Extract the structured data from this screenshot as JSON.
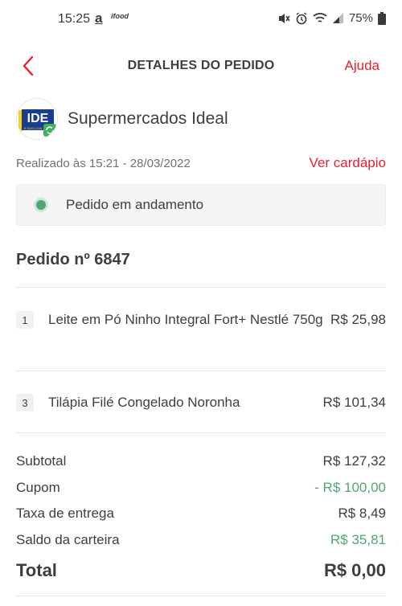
{
  "status_bar": {
    "time": "15:25",
    "a_icon": "a",
    "app_badge": "ifood",
    "battery": "75%"
  },
  "header": {
    "title": "DETALHES DO PEDIDO",
    "help": "Ajuda"
  },
  "store": {
    "name": "Supermercados Ideal",
    "logo_text": "IDE",
    "logo_sub": "A SUA LOJA",
    "date": "Realizado às 15:21 - 28/03/2022",
    "menu_link": "Ver cardápio"
  },
  "order": {
    "status": "Pedido em andamento",
    "number": "Pedido nº 6847",
    "items": [
      {
        "qty": "1",
        "name": "Leite em Pó Ninho Integral Fort+ Nestlé 750g",
        "price": "R$ 25,98"
      },
      {
        "qty": "3",
        "name": "Tilápia Filé Congelado Noronha",
        "price": "R$ 101,34"
      }
    ]
  },
  "summary": {
    "subtotal_label": "Subtotal",
    "subtotal_value": "R$ 127,32",
    "coupon_label": "Cupom",
    "coupon_value": "- R$ 100,00",
    "delivery_label": "Taxa de entrega",
    "delivery_value": "R$ 8,49",
    "wallet_label": "Saldo da carteira",
    "wallet_value": "R$ 35,81",
    "total_label": "Total",
    "total_value": "R$ 0,00"
  },
  "colors": {
    "brand_red": "#ea1d2c",
    "success_green": "#50a773"
  }
}
